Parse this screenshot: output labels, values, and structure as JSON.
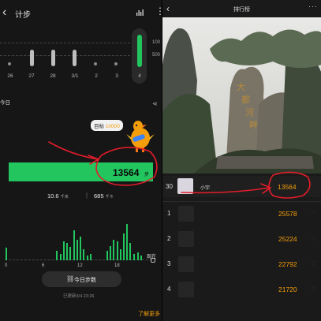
{
  "left": {
    "title": "计步",
    "axis": {
      "y_top": "100",
      "y_mid": "500"
    },
    "days": [
      "26",
      "27",
      "28",
      "3/1",
      "2",
      "3",
      "4"
    ],
    "today_label": "今日",
    "goal": {
      "label": "目标",
      "value": "10000"
    },
    "steps": "13564",
    "steps_unit": "步",
    "distance": "10.6",
    "distance_unit": "千米",
    "calories": "685",
    "calories_unit": "千卡",
    "hour_labels": [
      "0",
      "6",
      "12",
      "18"
    ],
    "now_label": "现在",
    "today_button": "今日步数",
    "updated": "已更新3/4 23:26",
    "learn_more": "了解更多"
  },
  "right": {
    "title": "排行榜",
    "me": {
      "rank": "30",
      "name": "小宇",
      "steps": "13564"
    },
    "ranks": [
      {
        "rank": "1",
        "steps": "25578"
      },
      {
        "rank": "2",
        "steps": "25224"
      },
      {
        "rank": "3",
        "steps": "22792"
      },
      {
        "rank": "4",
        "steps": "21720"
      }
    ]
  },
  "colors": {
    "accent_green": "#22c55e",
    "accent_orange": "#f59e0b",
    "annotation_red": "#e11d2a"
  },
  "icons": [
    "back-icon",
    "stats-icon",
    "more-icon",
    "share-icon",
    "link-icon",
    "heart-icon"
  ]
}
